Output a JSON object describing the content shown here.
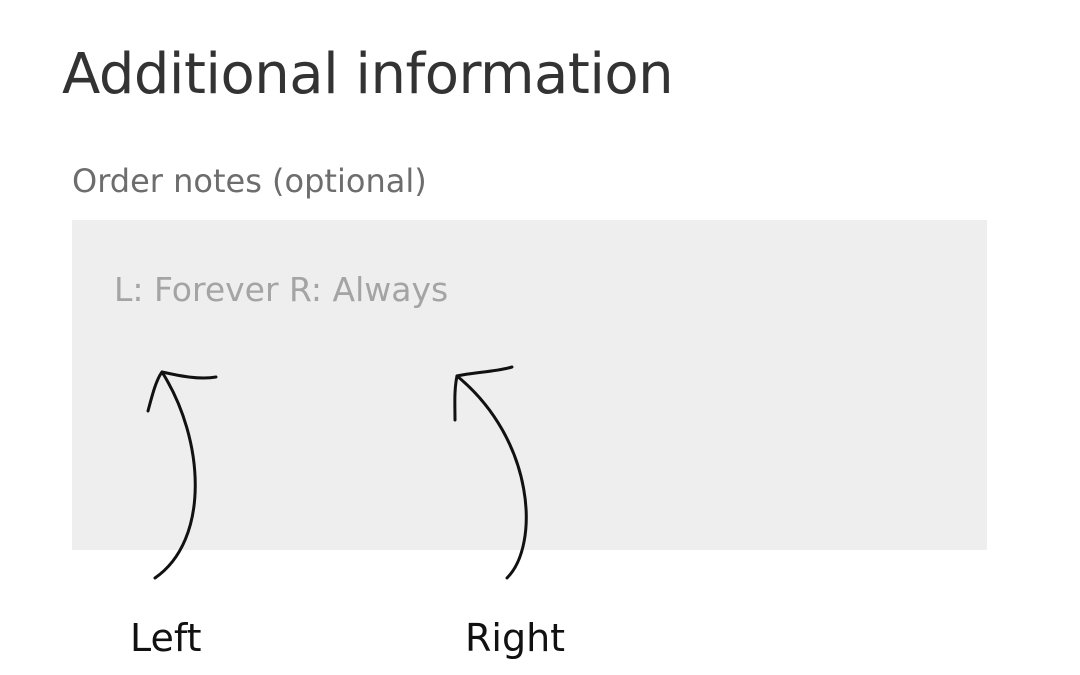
{
  "section": {
    "title": "Additional information"
  },
  "order_notes": {
    "label": "Order notes (optional)",
    "value": "",
    "placeholder": "L: Forever R: Always"
  },
  "annotations": {
    "left_label": "Left",
    "right_label": "Right"
  }
}
